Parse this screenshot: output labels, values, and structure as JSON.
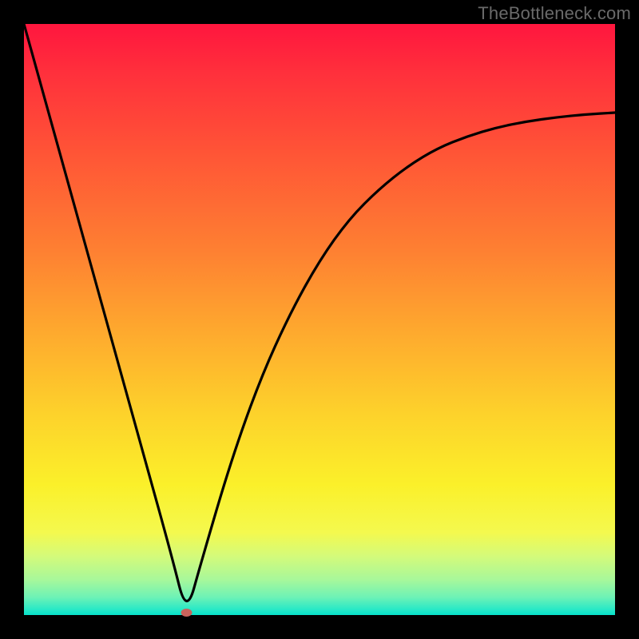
{
  "watermark": "TheBottleneck.com",
  "chart_data": {
    "type": "line",
    "title": "",
    "xlabel": "",
    "ylabel": "",
    "xlim": [
      0,
      100
    ],
    "ylim": [
      0,
      100
    ],
    "grid": false,
    "series": [
      {
        "name": "bottleneck-curve",
        "x": [
          0,
          5,
          10,
          15,
          20,
          25,
          27.5,
          30,
          35,
          40,
          45,
          50,
          55,
          60,
          65,
          70,
          75,
          80,
          85,
          90,
          95,
          100
        ],
        "values": [
          100,
          82,
          64,
          46,
          28,
          10,
          0,
          9,
          26,
          40,
          51,
          60,
          67,
          72,
          76,
          79,
          81,
          82.5,
          83.5,
          84.2,
          84.7,
          85
        ]
      }
    ],
    "marker": {
      "name": "bottleneck-minimum",
      "x": 27.5,
      "y": 0,
      "color": "#c9635c"
    },
    "background_gradient": {
      "top": "#ff163e",
      "middle": "#fdd22b",
      "bottom": "#07e2cb"
    }
  }
}
